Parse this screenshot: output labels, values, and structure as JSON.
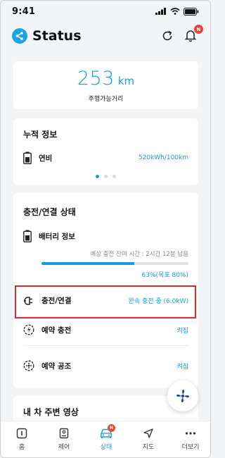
{
  "status_bar": {
    "time": "9:41"
  },
  "header": {
    "title": "Status",
    "bell_badge": "N"
  },
  "range": {
    "value": "253",
    "unit": "km",
    "label": "주행가능거리"
  },
  "accumulated": {
    "title": "누적 정보",
    "efficiency_label": "연비",
    "efficiency_value": "520kWh/100km",
    "pager_total": 3,
    "pager_active": 1
  },
  "charging": {
    "title": "충전/연결 상태",
    "battery_label": "배터리 정보",
    "remaining_time": "예상 충전 잔여 시간 : 2시간 12분 남음",
    "battery_level": 0.63,
    "battery_percent_text": "63%(목표 80%)",
    "connection_label": "충전/연결",
    "connection_value": "완속 충전 중 (6.0kW)",
    "reserve_charge_label": "예약 충전",
    "reserve_charge_value": "켜짐",
    "reserve_climate_label": "예약 공조",
    "reserve_climate_value": "켜짐"
  },
  "video": {
    "title": "내 차 주변 영상"
  },
  "bottom_nav": {
    "active_index": 2,
    "badge": "N",
    "items": [
      {
        "label": "홈",
        "icon": "home-icon"
      },
      {
        "label": "제어",
        "icon": "remote-icon"
      },
      {
        "label": "상태",
        "icon": "car-icon"
      },
      {
        "label": "지도",
        "icon": "navigation-icon"
      },
      {
        "label": "더보기",
        "icon": "more-icon"
      }
    ]
  },
  "colors": {
    "accent": "#1a9be0",
    "highlight_box": "#e0262e",
    "badge": "#e8453c"
  }
}
